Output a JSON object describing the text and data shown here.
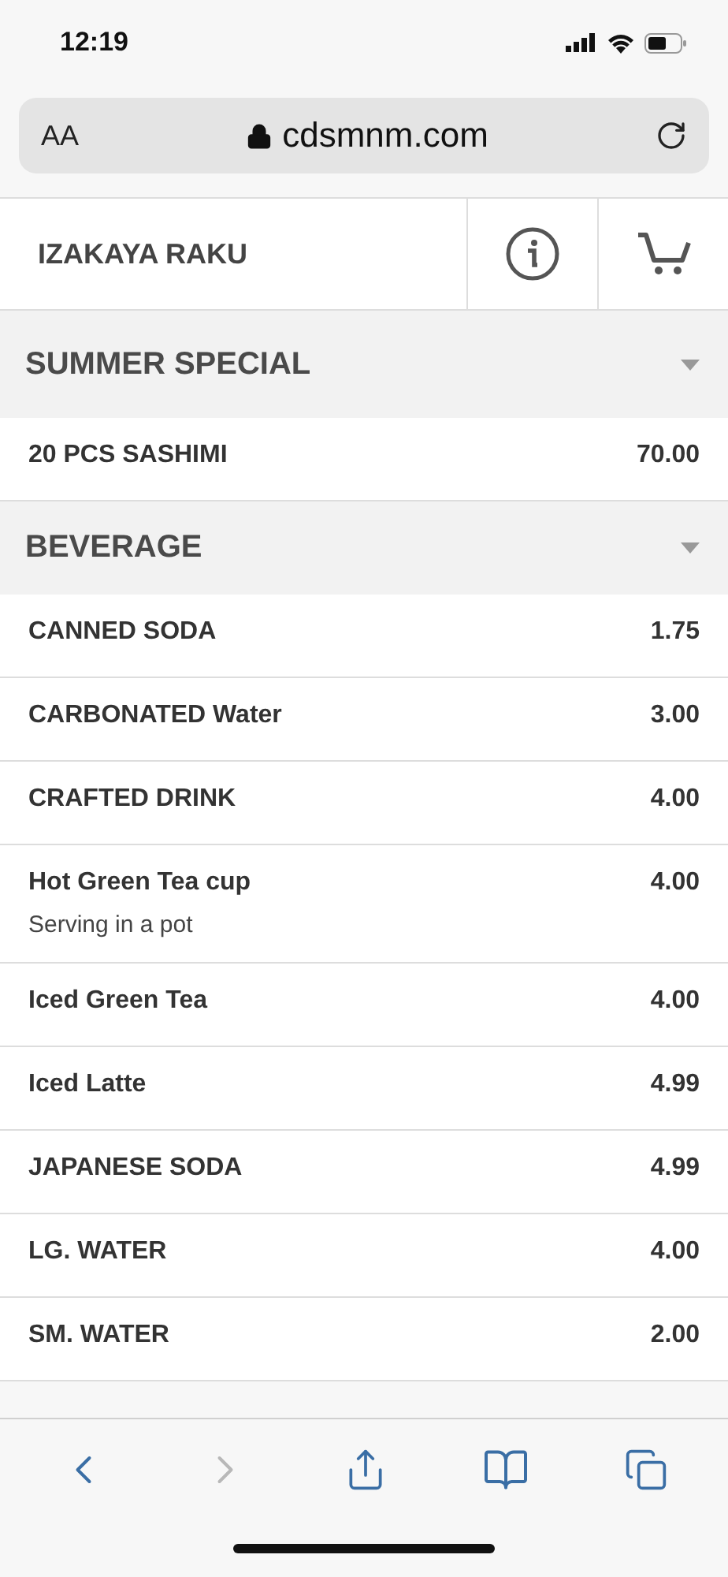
{
  "status_bar": {
    "time": "12:19"
  },
  "address_bar": {
    "text_size": "AA",
    "url": "cdsmnm.com"
  },
  "header": {
    "title": "IZAKAYA RAKU"
  },
  "sections": [
    {
      "title": "SUMMER SPECIAL",
      "items": [
        {
          "name": "20 PCS SASHIMI",
          "price": "70.00"
        }
      ]
    },
    {
      "title": "BEVERAGE",
      "items": [
        {
          "name": "CANNED SODA",
          "price": "1.75"
        },
        {
          "name": "CARBONATED Water",
          "price": "3.00"
        },
        {
          "name": "CRAFTED DRINK",
          "price": "4.00"
        },
        {
          "name": "Hot Green Tea cup",
          "price": "4.00",
          "description": "Serving in a pot"
        },
        {
          "name": "Iced Green Tea",
          "price": "4.00"
        },
        {
          "name": "Iced Latte",
          "price": "4.99"
        },
        {
          "name": "JAPANESE SODA",
          "price": "4.99"
        },
        {
          "name": "LG. WATER",
          "price": "4.00"
        },
        {
          "name": "SM. WATER",
          "price": "2.00"
        }
      ]
    }
  ],
  "toolbar": {
    "back": {
      "disabled": false
    },
    "forward": {
      "disabled": true
    }
  }
}
